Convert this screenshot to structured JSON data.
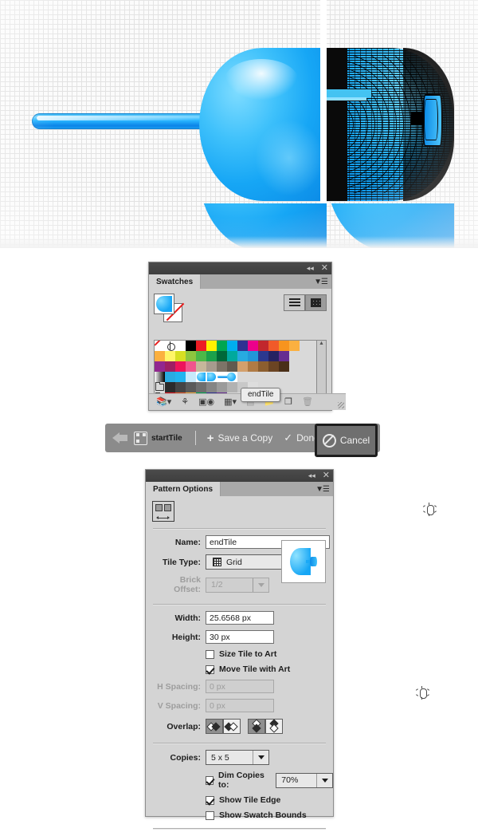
{
  "canvas": {
    "name": "pattern-edit-canvas",
    "artwork_description": "blue glossy pin artwork with half dome and wireframe selected half"
  },
  "swatches_panel": {
    "title": "Swatches",
    "titlebar": {
      "collapse_icon": "collapse-double-arrow-icon",
      "close_icon": "close-icon"
    },
    "menu_icon": "panel-menu-icon",
    "fill_stroke": {
      "fill_label": "fill-pattern",
      "stroke_label": "stroke-none"
    },
    "view_buttons": [
      {
        "name": "list-view-button",
        "selected": false
      },
      {
        "name": "grid-view-button",
        "selected": true
      }
    ],
    "tooltip": "endTile",
    "rows": [
      [
        "none",
        "registration",
        "#ffffff",
        "#000000",
        "#ed1c24",
        "#fff200",
        "#00a651",
        "#00aeef",
        "#2e3192",
        "#ec008c",
        "#c1272d",
        "#f15a29",
        "#f7941e",
        "#fbb040"
      ],
      [
        "#fbb040",
        "#fff568",
        "#d7df23",
        "#8dc63f",
        "#4cb848",
        "#1ba14b",
        "#006838",
        "#00a99d",
        "#27aae1",
        "#29abe2",
        "#2b388f",
        "#262262",
        "#662d91"
      ],
      [
        "#92278f",
        "#9e1f63",
        "#ed145b",
        "#f0558d",
        "#c6b79b",
        "#a79b8e",
        "#7d7468",
        "#615a4f",
        "#d3a06c",
        "#b07b45",
        "#8c5e2f",
        "#6b4423",
        "#4a2f18"
      ],
      [
        "gradient-bw",
        "#29abe2",
        "#22b4f0",
        "#c6e9fb",
        "pattern-half-left",
        "pattern-half-right",
        "pattern-pin"
      ],
      [
        "folder",
        "#2b2b2b",
        "#444444",
        "#5a5a5a",
        "#6e6e6e",
        "#858585",
        "#9b9b9b",
        "#b2b2b2",
        "#c8c8c8",
        "#dddddd"
      ],
      [
        "folder",
        "#ed1c24",
        "#f15a29",
        "#fbb040",
        "#00a651",
        "#2e3192",
        "#662d91"
      ]
    ],
    "scrollbar": {
      "up": "▲",
      "down": "▼"
    },
    "footer_icons": [
      "swatch-libraries-icon",
      "color-group-link-icon",
      "show-swatch-kinds-icon",
      "swatch-options-grid-icon",
      "swatch-options-icon",
      "new-color-group-icon",
      "new-swatch-icon",
      "delete-swatch-icon"
    ]
  },
  "pattern_toolbar": {
    "back_icon": "back-arrow-icon",
    "tile_icon": "pattern-tile-icon",
    "tile_name": "startTile",
    "save_copy_label": "Save a Copy",
    "save_copy_icon": "plus-icon",
    "done_label": "Done",
    "done_icon": "check-icon",
    "cancel_label": "Cancel",
    "cancel_icon": "ban-icon"
  },
  "pattern_options": {
    "title": "Pattern Options",
    "titlebar": {
      "collapse_icon": "collapse-double-arrow-icon",
      "close_icon": "close-icon"
    },
    "menu_icon": "panel-menu-icon",
    "tile_tool_icon": "pattern-tile-tool-icon",
    "name_label": "Name:",
    "name_value": "endTile",
    "tile_type_label": "Tile Type:",
    "tile_type_value": "Grid",
    "tile_type_icon": "grid-icon",
    "brick_offset_label": "Brick Offset:",
    "brick_offset_value": "1/2",
    "width_label": "Width:",
    "width_value": "25.6568 px",
    "height_label": "Height:",
    "height_value": "30 px",
    "constrain_icon": "constrain-proportions-icon",
    "size_tile_to_art_label": "Size Tile to Art",
    "size_tile_to_art_checked": false,
    "move_tile_with_art_label": "Move Tile with Art",
    "move_tile_with_art_checked": true,
    "h_spacing_label": "H Spacing:",
    "h_spacing_value": "0 px",
    "v_spacing_label": "V Spacing:",
    "v_spacing_value": "0 px",
    "spacing_constrain_icon": "constrain-spacing-icon",
    "overlap_label": "Overlap:",
    "overlap_buttons": [
      {
        "name": "overlap-left-in-front-button",
        "selected": true
      },
      {
        "name": "overlap-right-in-front-button",
        "selected": false
      },
      {
        "name": "overlap-top-in-front-button",
        "selected": true
      },
      {
        "name": "overlap-bottom-in-front-button",
        "selected": false
      }
    ],
    "copies_label": "Copies:",
    "copies_value": "5 x 5",
    "dim_copies_label": "Dim Copies to:",
    "dim_copies_checked": true,
    "dim_copies_value": "70%",
    "show_tile_edge_label": "Show Tile Edge",
    "show_tile_edge_checked": true,
    "show_swatch_bounds_label": "Show Swatch Bounds",
    "show_swatch_bounds_checked": false,
    "preview_icon": "pattern-preview-thumbnail"
  },
  "colors": {
    "accent_blue": "#16a6f5",
    "panel_bg": "#d4d4d4",
    "titlebar": "#434343",
    "toolbar_gray": "#8b8b8b"
  }
}
